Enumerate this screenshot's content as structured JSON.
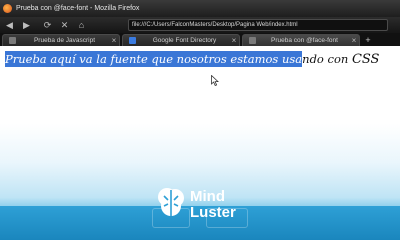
{
  "window": {
    "title": "Prueba con @face-font - Mozilla Firefox"
  },
  "toolbar": {
    "back_icon": "back-arrow-icon",
    "forward_icon": "forward-arrow-icon",
    "reload_icon": "reload-icon",
    "home_icon": "home-icon",
    "url": "file:///C:/Users/FalconMasters/Desktop/Pagina Web/index.html"
  },
  "tabs": [
    {
      "label": "Prueba de Javascript",
      "active": false
    },
    {
      "label": "Google Font Directory",
      "active": false
    },
    {
      "label": "Prueba con @face-font",
      "active": true
    }
  ],
  "page": {
    "selected_text": "Prueba aquí va la fuente que nosotros estamos usa",
    "rest_text": "ndo con ",
    "css_text": "CSS"
  },
  "watermark": {
    "line1": "Mind",
    "line2": "Luster",
    "icon": "brain-icon"
  },
  "colors": {
    "selection": "#3a76d6",
    "accent_blue": "#1e8fc6"
  }
}
